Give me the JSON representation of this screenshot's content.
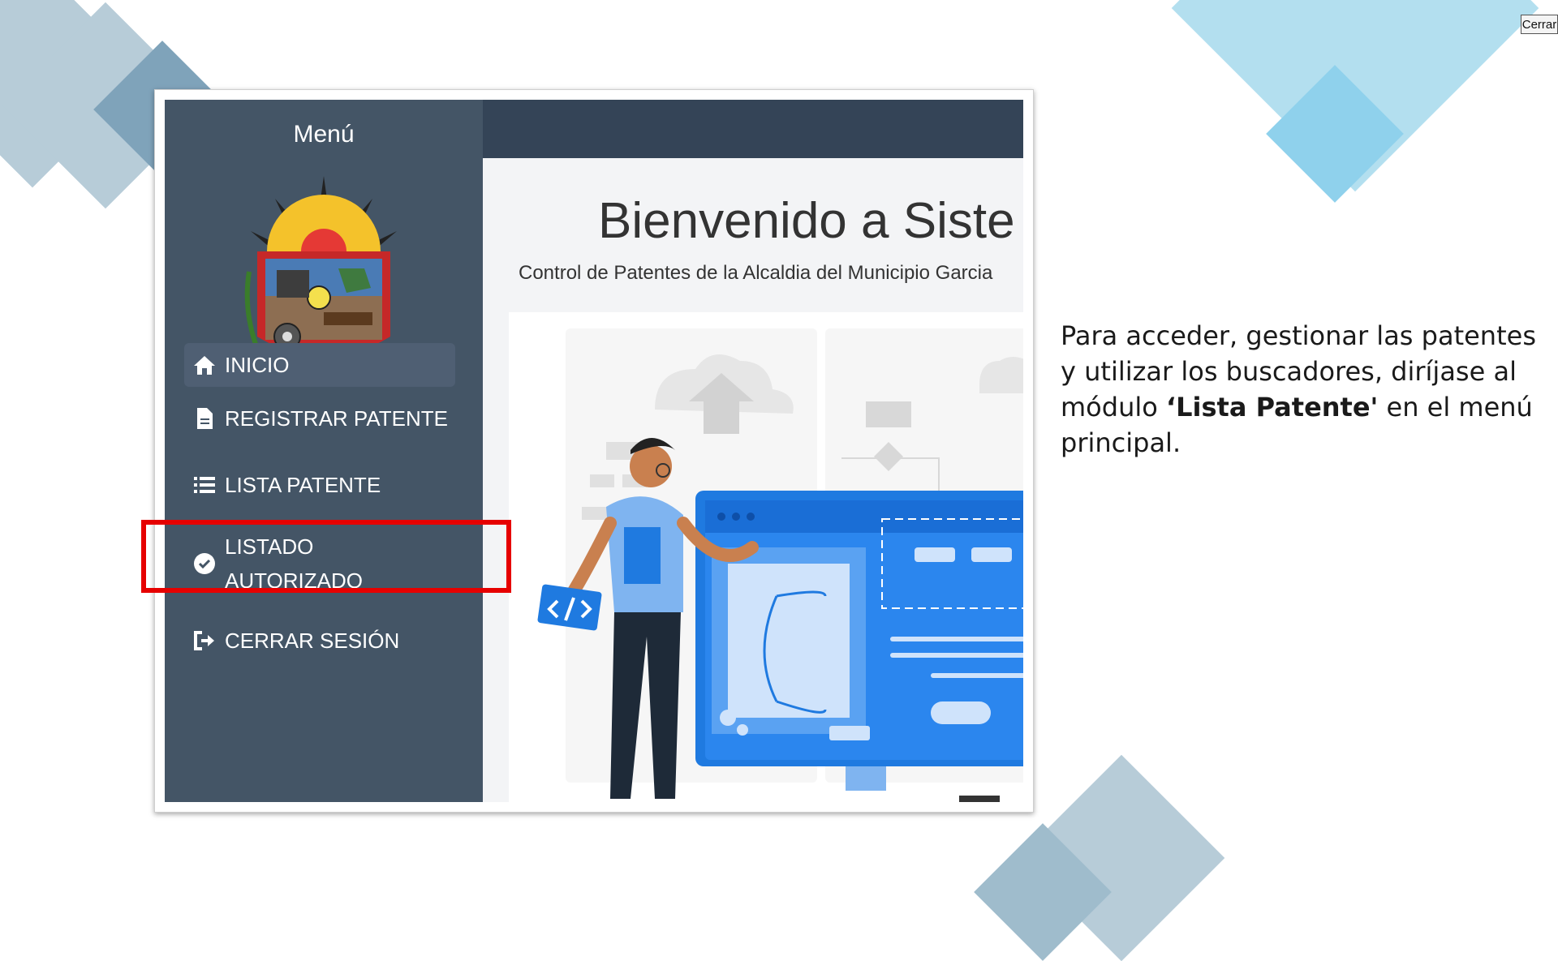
{
  "window": {
    "close_label": "Cerrar"
  },
  "sidebar": {
    "title": "Menú",
    "items": [
      {
        "label": "INICIO",
        "icon": "home-icon",
        "active": true
      },
      {
        "label": "REGISTRAR PATENTE",
        "icon": "file-icon"
      },
      {
        "label": "LISTA PATENTE",
        "icon": "list-icon",
        "highlighted": true
      },
      {
        "label": "LISTADO",
        "label2": "AUTORIZADO",
        "icon": "check-circle-icon"
      },
      {
        "label": "CERRAR SESIÓN",
        "icon": "logout-icon"
      }
    ]
  },
  "main": {
    "welcome": "Bienvenido a Siste",
    "subtitle": "Control de Patentes de la Alcaldia del Municipio Garcia"
  },
  "instructions": {
    "part1": "Para acceder, gestionar las patentes y utilizar los buscadores, diríjase al módulo ",
    "emphasis": "‘Lista Patente'",
    "part2": " en el menú principal."
  },
  "colors": {
    "sidebar": "#445566",
    "topbar": "#344457",
    "highlight": "#e60000",
    "illustration_blue": "#1f7ae0"
  }
}
